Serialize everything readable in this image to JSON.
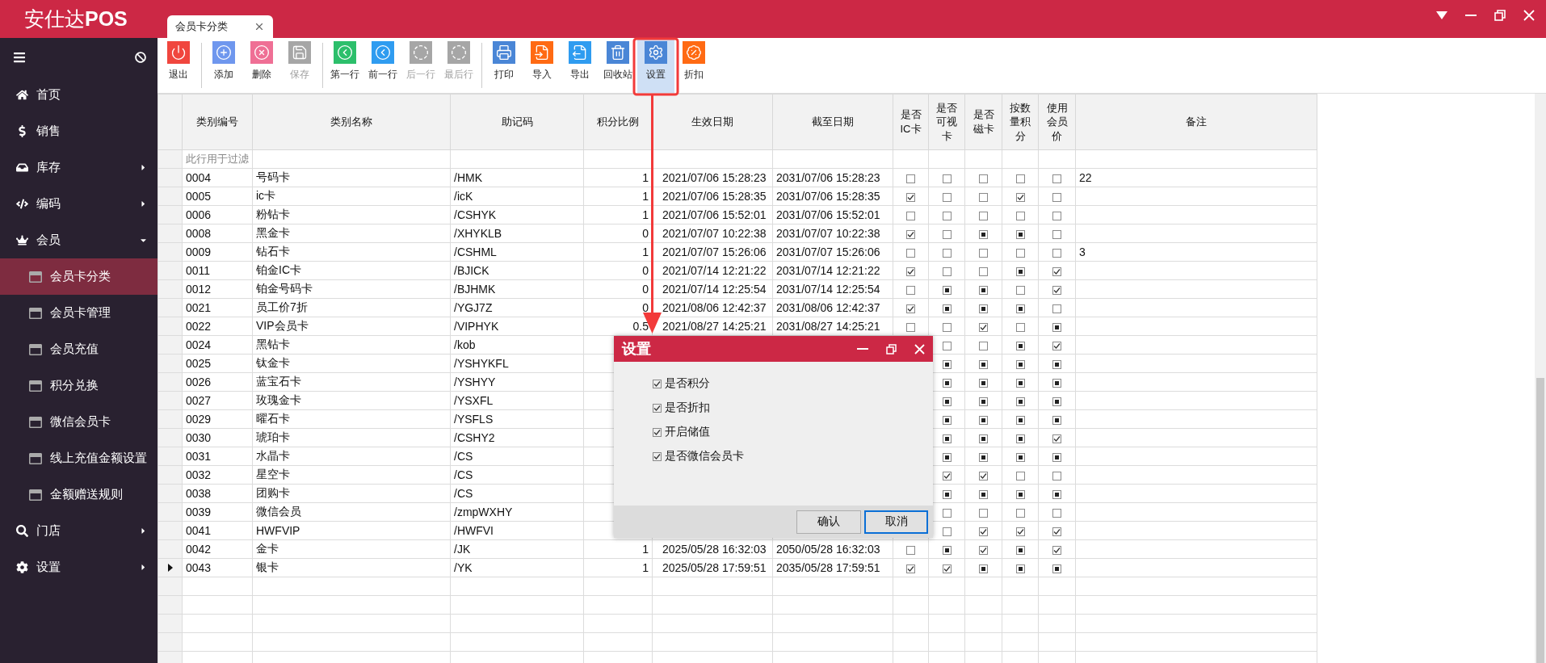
{
  "app_title": "安仕达**POS**",
  "tabs": [
    {
      "label": "会员卡分类",
      "selected": true
    }
  ],
  "sidebar": {
    "items": [
      {
        "label": "首页"
      },
      {
        "label": "销售"
      },
      {
        "label": "库存",
        "expanded": false
      },
      {
        "label": "编码",
        "expanded": false
      },
      {
        "label": "会员",
        "expanded": true,
        "children": [
          {
            "label": "会员卡分类",
            "selected": true
          },
          {
            "label": "会员卡管理",
            "selected": false
          },
          {
            "label": "会员充值",
            "selected": false
          },
          {
            "label": "积分兑换",
            "selected": false
          },
          {
            "label": "微信会员卡",
            "selected": false
          },
          {
            "label": "线上充值金额设置",
            "selected": false
          },
          {
            "label": "金额赠送规则",
            "selected": false
          }
        ]
      },
      {
        "label": "门店",
        "expanded": false
      },
      {
        "label": "设置",
        "expanded": false
      }
    ]
  },
  "toolbar": {
    "buttons": [
      {
        "label": "退出",
        "color": "#f0463e",
        "disabled": false,
        "selected": false
      },
      {
        "label": "添加",
        "color": "#6f97ee",
        "disabled": false,
        "selected": false
      },
      {
        "label": "删除",
        "color": "#ef6f95",
        "disabled": false,
        "selected": false
      },
      {
        "label": "保存",
        "color": "#a6a6a6",
        "disabled": true,
        "selected": false
      },
      {
        "label": "第一行",
        "color": "#2cbf6b",
        "disabled": false,
        "selected": false
      },
      {
        "label": "前一行",
        "color": "#2f9cf0",
        "disabled": false,
        "selected": false
      },
      {
        "label": "后一行",
        "color": "#a6a6a6",
        "disabled": true,
        "selected": false
      },
      {
        "label": "最后行",
        "color": "#a6a6a6",
        "disabled": true,
        "selected": false
      },
      {
        "label": "打印",
        "color": "#4a86d6",
        "disabled": false,
        "selected": false
      },
      {
        "label": "导入",
        "color": "#ff6a13",
        "disabled": false,
        "selected": false
      },
      {
        "label": "导出",
        "color": "#2f9cf0",
        "disabled": false,
        "selected": false
      },
      {
        "label": "回收站",
        "color": "#4a86d6",
        "disabled": false,
        "selected": false
      },
      {
        "label": "设置",
        "color": "#4a86d6",
        "disabled": false,
        "selected": true
      },
      {
        "label": "折扣",
        "color": "#ff6a13",
        "disabled": false,
        "selected": false
      }
    ]
  },
  "table": {
    "columns": [
      "类别编号",
      "类别名称",
      "助记码",
      "积分比例",
      "生效日期",
      "截至日期",
      "是否IC卡",
      "是否可视卡",
      "是否磁卡",
      "按数量积分",
      "使用会员价",
      "备注"
    ],
    "filter_hint": "此行用于过滤",
    "rows": [
      {
        "current": false,
        "code": "0004",
        "name": "号码卡",
        "mnemonic": "/HMK",
        "ratio": "1",
        "start": "2021/07/06 15:28:23",
        "end": "2031/07/06 15:28:23",
        "flags": {
          "ic": {
            "checked": false
          },
          "visible": {
            "checked": false
          },
          "magnetic": {
            "checked": false
          },
          "points_by_qty": {
            "checked": false
          },
          "member_price": {
            "checked": false
          }
        },
        "note": "22"
      },
      {
        "current": false,
        "code": "0005",
        "name": "ic卡",
        "mnemonic": "/icK",
        "ratio": "1",
        "start": "2021/07/06 15:28:35",
        "end": "2031/07/06 15:28:35",
        "flags": {
          "ic": {
            "checked": true
          },
          "visible": {
            "checked": false
          },
          "magnetic": {
            "checked": false
          },
          "points_by_qty": {
            "checked": true
          },
          "member_price": {
            "checked": false
          }
        }
      },
      {
        "current": false,
        "code": "0006",
        "name": "粉钻卡",
        "mnemonic": "/CSHYK",
        "ratio": "1",
        "start": "2021/07/06 15:52:01",
        "end": "2031/07/06 15:52:01",
        "flags": {
          "ic": {
            "checked": false
          },
          "visible": {
            "checked": false
          },
          "magnetic": {
            "checked": false
          },
          "points_by_qty": {
            "checked": false
          },
          "member_price": {
            "checked": false
          }
        }
      },
      {
        "current": false,
        "code": "0008",
        "name": "黑金卡",
        "mnemonic": "/XHYKLB",
        "ratio": "0",
        "start": "2021/07/07 10:22:38",
        "end": "2031/07/07 10:22:38",
        "flags": {
          "ic": {
            "checked": true
          },
          "visible": {
            "checked": false
          },
          "magnetic": {
            "mixed": true
          },
          "points_by_qty": {
            "mixed": true
          },
          "member_price": {
            "checked": false
          }
        }
      },
      {
        "current": false,
        "code": "0009",
        "name": "钻石卡",
        "mnemonic": "/CSHML",
        "ratio": "1",
        "start": "2021/07/07 15:26:06",
        "end": "2031/07/07 15:26:06",
        "flags": {
          "ic": {
            "checked": false
          },
          "visible": {
            "checked": false
          },
          "magnetic": {
            "checked": false
          },
          "points_by_qty": {
            "checked": false
          },
          "member_price": {
            "checked": false
          }
        },
        "note": "3"
      },
      {
        "current": false,
        "code": "0011",
        "name": "铂金IC卡",
        "mnemonic": "/BJICK",
        "ratio": "0",
        "start": "2021/07/14 12:21:22",
        "end": "2031/07/14 12:21:22",
        "flags": {
          "ic": {
            "checked": true
          },
          "visible": {
            "checked": false
          },
          "magnetic": {
            "checked": false
          },
          "points_by_qty": {
            "mixed": true
          },
          "member_price": {
            "checked": true
          }
        }
      },
      {
        "current": false,
        "code": "0012",
        "name": "铂金号码卡",
        "mnemonic": "/BJHMK",
        "ratio": "0",
        "start": "2021/07/14 12:25:54",
        "end": "2031/07/14 12:25:54",
        "flags": {
          "ic": {
            "checked": false
          },
          "visible": {
            "mixed": true
          },
          "magnetic": {
            "mixed": true
          },
          "points_by_qty": {
            "checked": false
          },
          "member_price": {
            "checked": true
          }
        }
      },
      {
        "current": false,
        "code": "0021",
        "name": "员工价7折",
        "mnemonic": "/YGJ7Z",
        "ratio": "0",
        "start": "2021/08/06 12:42:37",
        "end": "2031/08/06 12:42:37",
        "flags": {
          "ic": {
            "checked": true
          },
          "visible": {
            "mixed": true
          },
          "magnetic": {
            "mixed": true
          },
          "points_by_qty": {
            "mixed": true
          },
          "member_price": {
            "checked": false
          }
        }
      },
      {
        "current": false,
        "code": "0022",
        "name": "VIP会员卡",
        "mnemonic": "/VIPHYK",
        "ratio": "0.5",
        "start": "2021/08/27 14:25:21",
        "end": "2031/08/27 14:25:21",
        "flags": {
          "ic": {
            "checked": false
          },
          "visible": {
            "checked": false
          },
          "magnetic": {
            "checked": true
          },
          "points_by_qty": {
            "checked": false
          },
          "member_price": {
            "mixed": true
          }
        }
      },
      {
        "current": false,
        "code": "0024",
        "name": "黑钻卡",
        "mnemonic": "/kob",
        "flags": {
          "visible": {
            "checked": false
          },
          "magnetic": {
            "checked": false
          },
          "points_by_qty": {
            "mixed": true
          },
          "member_price": {
            "checked": true
          }
        }
      },
      {
        "current": false,
        "code": "0025",
        "name": "钛金卡",
        "mnemonic": "/YSHYKFL",
        "flags": {
          "visible": {
            "mixed": true
          },
          "magnetic": {
            "mixed": true
          },
          "points_by_qty": {
            "mixed": true
          },
          "member_price": {
            "mixed": true
          }
        }
      },
      {
        "current": false,
        "code": "0026",
        "name": "蓝宝石卡",
        "mnemonic": "/YSHYY",
        "flags": {
          "visible": {
            "mixed": true
          },
          "magnetic": {
            "mixed": true
          },
          "points_by_qty": {
            "mixed": true
          },
          "member_price": {
            "mixed": true
          }
        }
      },
      {
        "current": false,
        "code": "0027",
        "name": "玫瑰金卡",
        "mnemonic": "/YSXFL",
        "flags": {
          "visible": {
            "mixed": true
          },
          "magnetic": {
            "mixed": true
          },
          "points_by_qty": {
            "mixed": true
          },
          "member_price": {
            "mixed": true
          }
        }
      },
      {
        "current": false,
        "code": "0029",
        "name": "曜石卡",
        "mnemonic": "/YSFLS",
        "flags": {
          "visible": {
            "mixed": true
          },
          "magnetic": {
            "mixed": true
          },
          "points_by_qty": {
            "mixed": true
          },
          "member_price": {
            "mixed": true
          }
        }
      },
      {
        "current": false,
        "code": "0030",
        "name": "琥珀卡",
        "mnemonic": "/CSHY2",
        "flags": {
          "visible": {
            "mixed": true
          },
          "magnetic": {
            "mixed": true
          },
          "points_by_qty": {
            "mixed": true
          },
          "member_price": {
            "checked": true
          }
        }
      },
      {
        "current": false,
        "code": "0031",
        "name": "水晶卡",
        "mnemonic": "/CS",
        "flags": {
          "visible": {
            "mixed": true
          },
          "magnetic": {
            "mixed": true
          },
          "points_by_qty": {
            "mixed": true
          },
          "member_price": {
            "mixed": true
          }
        }
      },
      {
        "current": false,
        "code": "0032",
        "name": "星空卡",
        "mnemonic": "/CS",
        "flags": {
          "visible": {
            "checked": true
          },
          "magnetic": {
            "checked": true
          },
          "points_by_qty": {
            "checked": false
          },
          "member_price": {
            "checked": false
          }
        }
      },
      {
        "current": false,
        "code": "0038",
        "name": "团购卡",
        "mnemonic": "/CS",
        "flags": {
          "visible": {
            "mixed": true
          },
          "magnetic": {
            "mixed": true
          },
          "points_by_qty": {
            "mixed": true
          },
          "member_price": {
            "mixed": true
          }
        }
      },
      {
        "current": false,
        "code": "0039",
        "name": "微信会员",
        "mnemonic": "/zmpWXHY",
        "flags": {
          "visible": {
            "checked": false
          },
          "magnetic": {
            "checked": false
          },
          "points_by_qty": {
            "checked": false
          },
          "member_price": {
            "checked": false
          }
        }
      },
      {
        "current": false,
        "code": "0041",
        "name": "HWFVIP",
        "mnemonic": "/HWFVI",
        "flags": {
          "visible": {
            "checked": false
          },
          "magnetic": {
            "checked": true
          },
          "points_by_qty": {
            "checked": true
          },
          "member_price": {
            "checked": true
          }
        }
      },
      {
        "current": false,
        "code": "0042",
        "name": "金卡",
        "mnemonic": "/JK",
        "ratio": "1",
        "start": "2025/05/28 16:32:03",
        "end": "2050/05/28 16:32:03",
        "flags": {
          "ic": {
            "checked": false
          },
          "visible": {
            "mixed": true
          },
          "magnetic": {
            "checked": true
          },
          "points_by_qty": {
            "mixed": true
          },
          "member_price": {
            "checked": true
          }
        }
      },
      {
        "current": true,
        "code": "0043",
        "name": "银卡",
        "mnemonic": "/YK",
        "ratio": "1",
        "start": "2025/05/28 17:59:51",
        "end": "2035/05/28 17:59:51",
        "flags": {
          "ic": {
            "checked": true
          },
          "visible": {
            "checked": true
          },
          "magnetic": {
            "mixed": true
          },
          "points_by_qty": {
            "mixed": true
          },
          "member_price": {
            "mixed": true
          }
        }
      }
    ]
  },
  "dialog": {
    "title": "设置",
    "options": [
      {
        "label": "是否积分",
        "checked": true
      },
      {
        "label": "是否折扣",
        "checked": true
      },
      {
        "label": "开启储值",
        "checked": true
      },
      {
        "label": "是否微信会员卡",
        "checked": true
      }
    ],
    "buttons": [
      {
        "label": "确认",
        "focused": false
      },
      {
        "label": "取消",
        "focused": true
      }
    ]
  }
}
